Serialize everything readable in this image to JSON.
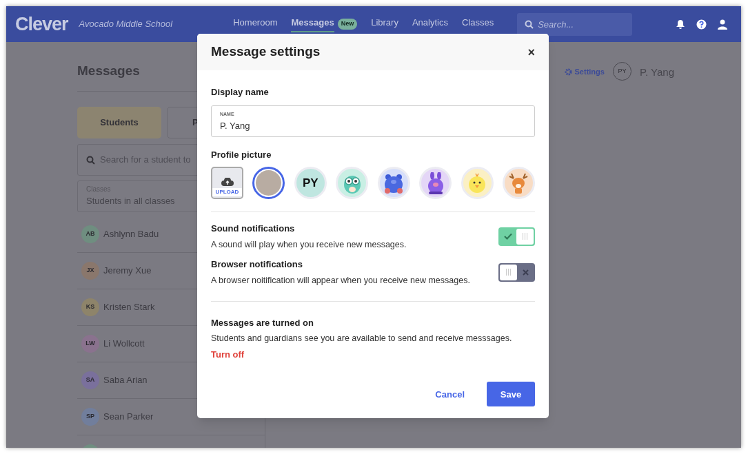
{
  "nav": {
    "logo": "Clever",
    "school": "Avocado Middle School",
    "links": [
      {
        "label": "Homeroom",
        "selected": false
      },
      {
        "label": "Messages",
        "selected": true,
        "badge": "New"
      },
      {
        "label": "Library",
        "selected": false
      },
      {
        "label": "Analytics",
        "selected": false
      },
      {
        "label": "Classes",
        "selected": false
      }
    ],
    "search": {
      "placeholder": "Search..."
    }
  },
  "page": {
    "title": "Messages",
    "tabs": [
      {
        "label": "Students",
        "selected": true
      },
      {
        "label": "P",
        "selected": false
      }
    ],
    "search": {
      "placeholder": "Search for a student to"
    },
    "classes": {
      "label": "Classes",
      "value": "Students in all classes"
    },
    "students": [
      {
        "initials": "AB",
        "name": "Ashlynn Badu",
        "color": "#6f8e80"
      },
      {
        "initials": "JX",
        "name": "Jeremy Xue",
        "color": "#8a776c"
      },
      {
        "initials": "KS",
        "name": "Kristen Stark",
        "color": "#8e846a"
      },
      {
        "initials": "LW",
        "name": "Li Wollcott",
        "color": "#8a728e"
      },
      {
        "initials": "SA",
        "name": "Saba Arian",
        "color": "#7a709c"
      },
      {
        "initials": "SP",
        "name": "Sean Parker",
        "color": "#717e9c"
      },
      {
        "color": "#6f8e80"
      }
    ],
    "settings_link": "Settings",
    "user": {
      "initials": "PY",
      "name": "P. Yang"
    }
  },
  "modal": {
    "title": "Message settings",
    "close": "×",
    "display_name": {
      "label": "Display name",
      "field_label": "NAME",
      "value": "P. Yang"
    },
    "profile_picture": {
      "label": "Profile picture",
      "options": [
        {
          "kind": "upload",
          "label": "UPLOAD",
          "selected": false
        },
        {
          "kind": "photo",
          "selected": true
        },
        {
          "kind": "initials",
          "label": "PY",
          "selected": false
        },
        {
          "kind": "owl",
          "selected": false
        },
        {
          "kind": "bear",
          "selected": false
        },
        {
          "kind": "kangaroo",
          "selected": false
        },
        {
          "kind": "chick",
          "selected": false
        },
        {
          "kind": "deer",
          "selected": false
        }
      ]
    },
    "notifications": [
      {
        "title": "Sound notifications",
        "description": "A sound will play when you receive new messages.",
        "on": true
      },
      {
        "title": "Browser notifications",
        "description": "A browser noitification will appear when you receive new messages.",
        "on": false
      }
    ],
    "status": {
      "title": "Messages are turned on",
      "description": "Students and guardians see you are available to send and receive messsages.",
      "action": "Turn off"
    },
    "buttons": {
      "cancel": "Cancel",
      "save": "Save"
    }
  }
}
